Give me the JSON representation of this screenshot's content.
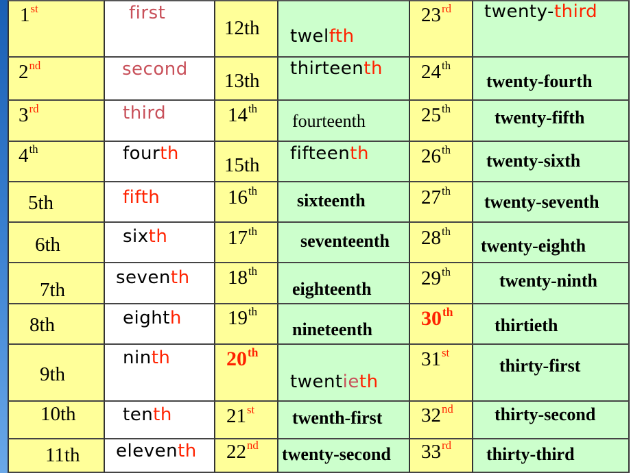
{
  "colors": {
    "yellow": "#ffff99",
    "green": "#ccffcc",
    "white": "#ffffff",
    "red": "#ff2200",
    "dusty": "#c8505a",
    "black": "#000000",
    "border": "#333333",
    "strip": "#2a70c8"
  },
  "rows": [
    [
      {
        "parts": [
          {
            "t": "1"
          },
          {
            "t": "st",
            "sup": true,
            "color": "red"
          }
        ]
      },
      {
        "parts": [
          {
            "t": "first",
            "color": "dusty"
          }
        ]
      },
      {
        "parts": [
          {
            "t": "12th"
          }
        ]
      },
      {
        "parts": [
          {
            "t": "twel"
          },
          {
            "t": "f",
            "color": "red"
          },
          {
            "t": "th",
            "color": "red"
          }
        ]
      },
      {
        "parts": [
          {
            "t": "23"
          },
          {
            "t": "rd",
            "sup": true,
            "color": "red"
          }
        ]
      },
      {
        "parts": [
          {
            "t": "twenty-"
          },
          {
            "t": "third",
            "color": "red"
          }
        ]
      }
    ],
    [
      {
        "parts": [
          {
            "t": "2"
          },
          {
            "t": "nd",
            "sup": true,
            "color": "red"
          }
        ]
      },
      {
        "parts": [
          {
            "t": "second",
            "color": "dusty"
          }
        ]
      },
      {
        "parts": [
          {
            "t": "13th"
          }
        ]
      },
      {
        "parts": [
          {
            "t": "thirteen"
          },
          {
            "t": "th",
            "color": "red"
          }
        ]
      },
      {
        "parts": [
          {
            "t": "24"
          },
          {
            "t": "th",
            "sup": true
          }
        ]
      },
      {
        "parts": [
          {
            "t": "twenty-fourth"
          }
        ]
      }
    ],
    [
      {
        "parts": [
          {
            "t": "3"
          },
          {
            "t": "rd",
            "sup": true,
            "color": "red"
          }
        ]
      },
      {
        "parts": [
          {
            "t": "third",
            "color": "dusty"
          }
        ]
      },
      {
        "parts": [
          {
            "t": "14"
          },
          {
            "t": "th",
            "sup": true
          }
        ]
      },
      {
        "parts": [
          {
            "t": "fourteenth"
          }
        ]
      },
      {
        "parts": [
          {
            "t": "25"
          },
          {
            "t": "th",
            "sup": true
          }
        ]
      },
      {
        "parts": [
          {
            "t": "twenty-fifth"
          }
        ]
      }
    ],
    [
      {
        "parts": [
          {
            "t": "4"
          },
          {
            "t": "th",
            "sup": true
          }
        ]
      },
      {
        "parts": [
          {
            "t": "four"
          },
          {
            "t": "th",
            "color": "red"
          }
        ]
      },
      {
        "parts": [
          {
            "t": "15th"
          }
        ]
      },
      {
        "parts": [
          {
            "t": "fifteen"
          },
          {
            "t": "th",
            "color": "red"
          }
        ]
      },
      {
        "parts": [
          {
            "t": "26"
          },
          {
            "t": "th",
            "sup": true
          }
        ]
      },
      {
        "parts": [
          {
            "t": "twenty-sixth"
          }
        ]
      }
    ],
    [
      {
        "parts": [
          {
            "t": "5th"
          }
        ]
      },
      {
        "parts": [
          {
            "t": "fifth",
            "color": "red"
          }
        ]
      },
      {
        "parts": [
          {
            "t": "16"
          },
          {
            "t": "th",
            "sup": true
          }
        ]
      },
      {
        "parts": [
          {
            "t": "sixteenth"
          }
        ]
      },
      {
        "parts": [
          {
            "t": "27"
          },
          {
            "t": "th",
            "sup": true
          }
        ]
      },
      {
        "parts": [
          {
            "t": "twenty-seventh"
          }
        ]
      }
    ],
    [
      {
        "parts": [
          {
            "t": "6th"
          }
        ]
      },
      {
        "parts": [
          {
            "t": "six"
          },
          {
            "t": "th",
            "color": "red"
          }
        ]
      },
      {
        "parts": [
          {
            "t": "17"
          },
          {
            "t": "th",
            "sup": true
          }
        ]
      },
      {
        "parts": [
          {
            "t": "seventeenth"
          }
        ]
      },
      {
        "parts": [
          {
            "t": "28"
          },
          {
            "t": "th",
            "sup": true
          }
        ]
      },
      {
        "parts": [
          {
            "t": "twenty-eighth"
          }
        ]
      }
    ],
    [
      {
        "parts": [
          {
            "t": "7th"
          }
        ]
      },
      {
        "parts": [
          {
            "t": "seven"
          },
          {
            "t": "th",
            "color": "red"
          }
        ]
      },
      {
        "parts": [
          {
            "t": "18"
          },
          {
            "t": "th",
            "sup": true
          }
        ]
      },
      {
        "parts": [
          {
            "t": "eighteenth"
          }
        ]
      },
      {
        "parts": [
          {
            "t": "29"
          },
          {
            "t": "th",
            "sup": true
          }
        ]
      },
      {
        "parts": [
          {
            "t": "twenty-ninth"
          }
        ]
      }
    ],
    [
      {
        "parts": [
          {
            "t": "8th"
          }
        ]
      },
      {
        "parts": [
          {
            "t": "eight"
          },
          {
            "t": "h",
            "color": "red"
          }
        ]
      },
      {
        "parts": [
          {
            "t": "19"
          },
          {
            "t": "th",
            "sup": true
          }
        ]
      },
      {
        "parts": [
          {
            "t": "nineteenth"
          }
        ]
      },
      {
        "parts": [
          {
            "t": "30",
            "color": "red"
          },
          {
            "t": "th",
            "sup": true,
            "color": "red"
          }
        ]
      },
      {
        "parts": [
          {
            "t": "thirtieth"
          }
        ]
      }
    ],
    [
      {
        "parts": [
          {
            "t": "9th"
          }
        ]
      },
      {
        "parts": [
          {
            "t": "nin"
          },
          {
            "t": "th",
            "color": "red"
          }
        ]
      },
      {
        "parts": [
          {
            "t": "20",
            "color": "red"
          },
          {
            "t": "th",
            "sup": true,
            "color": "red"
          }
        ]
      },
      {
        "parts": [
          {
            "t": "twent"
          },
          {
            "t": "ie",
            "color": "dusty"
          },
          {
            "t": "th",
            "color": "red"
          }
        ]
      },
      {
        "parts": [
          {
            "t": "31"
          },
          {
            "t": "st",
            "sup": true,
            "color": "red"
          }
        ]
      },
      {
        "parts": [
          {
            "t": "thirty-first"
          }
        ]
      }
    ],
    [
      {
        "parts": [
          {
            "t": "10th"
          }
        ]
      },
      {
        "parts": [
          {
            "t": "ten"
          },
          {
            "t": "th",
            "color": "red"
          }
        ]
      },
      {
        "parts": [
          {
            "t": "21"
          },
          {
            "t": "st",
            "sup": true,
            "color": "red"
          }
        ]
      },
      {
        "parts": [
          {
            "t": "twenth-first"
          }
        ]
      },
      {
        "parts": [
          {
            "t": "32"
          },
          {
            "t": "nd",
            "sup": true,
            "color": "red"
          }
        ]
      },
      {
        "parts": [
          {
            "t": "thirty-second"
          }
        ]
      }
    ],
    [
      {
        "parts": [
          {
            "t": "11th"
          }
        ]
      },
      {
        "parts": [
          {
            "t": "eleven"
          },
          {
            "t": "th",
            "color": "red"
          }
        ]
      },
      {
        "parts": [
          {
            "t": "22"
          },
          {
            "t": "nd",
            "sup": true,
            "color": "red"
          }
        ]
      },
      {
        "parts": [
          {
            "t": "twenty-second"
          }
        ]
      },
      {
        "parts": [
          {
            "t": "33"
          },
          {
            "t": "rd",
            "sup": true,
            "color": "red"
          }
        ]
      },
      {
        "parts": [
          {
            "t": "thirty-third"
          }
        ]
      }
    ]
  ]
}
